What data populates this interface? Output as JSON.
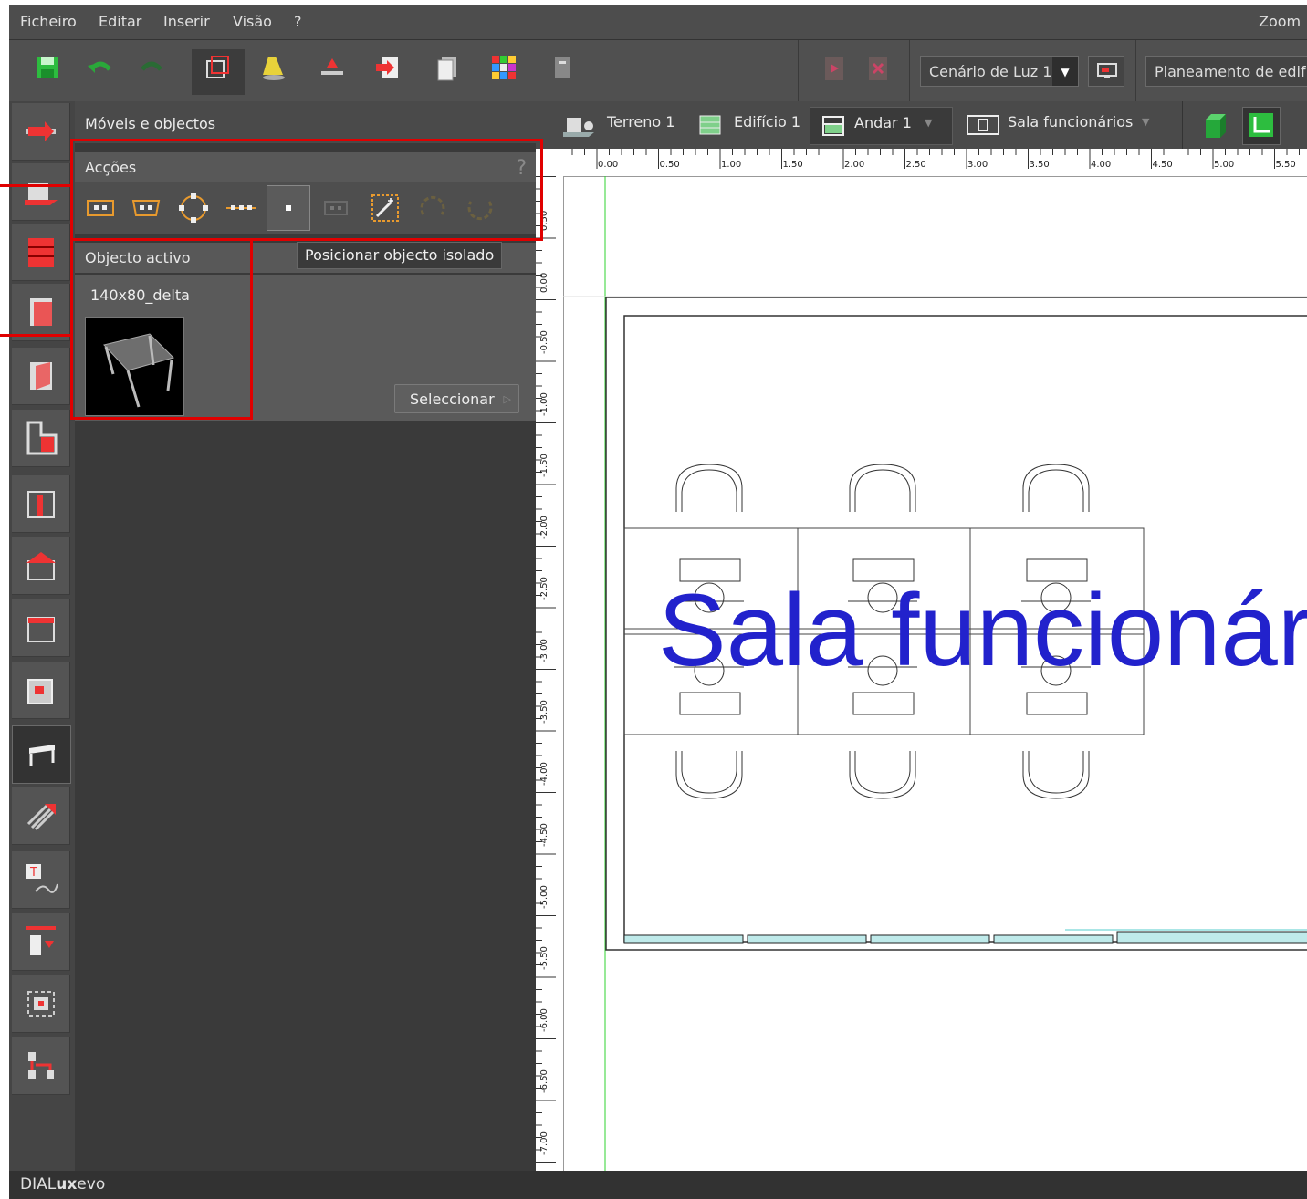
{
  "menu": {
    "file": "Ficheiro",
    "edit": "Editar",
    "insert": "Inserir",
    "view": "Visão",
    "help": "?",
    "zoom": "Zoom"
  },
  "toolbar": {
    "scene_label": "Cenário de Luz 1",
    "planning_label": "Planeamento de edifíc"
  },
  "panel": {
    "title": "Móveis e objectos",
    "actions_title": "Acções",
    "help_mark": "?",
    "active_object_title": "Objecto activo",
    "active_object_name": "140x80_delta",
    "select_button": "Seleccionar",
    "tooltip": "Posicionar objecto isolado"
  },
  "viewport": {
    "tabs": [
      "Terreno 1",
      "Edifício 1",
      "Andar 1",
      "Sala funcionários"
    ],
    "room_label": "Sala funcionári",
    "h_ruler": [
      "0.00",
      "0.50",
      "1.00",
      "1.50",
      "2.00",
      "2.50",
      "3.00",
      "3.50",
      "4.00",
      "4.50",
      "5.00",
      "5.50"
    ],
    "v_ruler": [
      "0.50",
      "0.00",
      "-0.50",
      "-1.00",
      "-1.50",
      "-2.00",
      "-2.50",
      "-3.00",
      "-3.50",
      "-4.00",
      "-4.50",
      "-5.00",
      "-5.50",
      "-6.00",
      "-6.50",
      "-7.00"
    ]
  },
  "status": {
    "brand_prefix": "DIAL",
    "brand_bold": "ux",
    "brand_suffix": "evo"
  },
  "colors": {
    "accent_red": "#e00000",
    "room_label_blue": "#2222cc",
    "save_green": "#2dbd3f"
  }
}
